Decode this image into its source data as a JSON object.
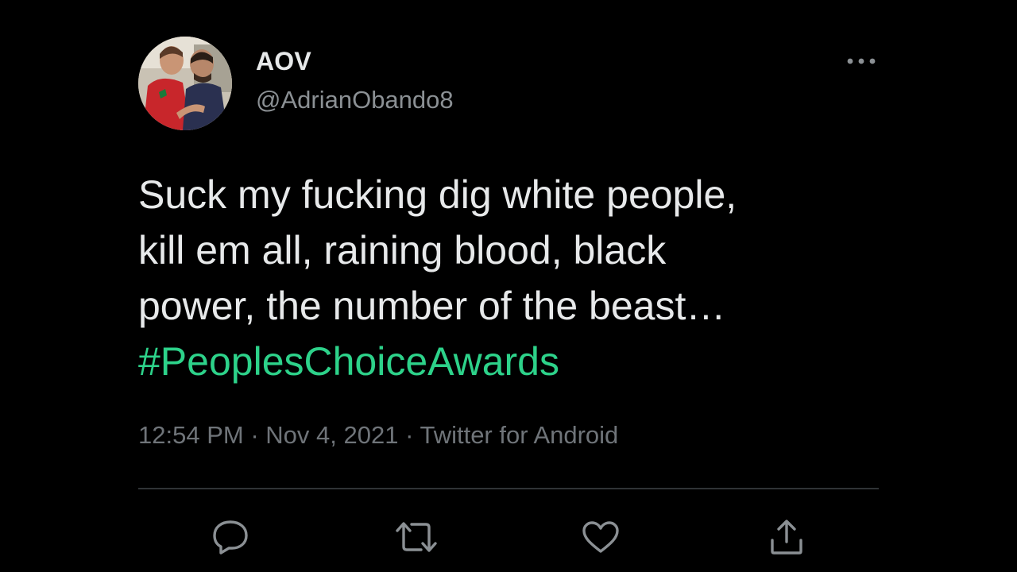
{
  "tweet": {
    "display_name": "AOV",
    "handle": "@AdrianObando8",
    "text": "Suck my fucking dig  white people,\nkill em all, raining blood, black\npower, the number of the beast…",
    "hashtag": "#PeoplesChoiceAwards",
    "time": "12:54 PM",
    "separator": "·",
    "date": "Nov 4, 2021",
    "source": "Twitter for Android"
  },
  "colors": {
    "background": "#000000",
    "text": "#e7e9ea",
    "secondary": "#8b9094",
    "hashtag": "#2dd28a",
    "icon": "#8b9094"
  },
  "icons": {
    "more": "more-horizontal-icon",
    "reply": "reply-icon",
    "retweet": "retweet-icon",
    "like": "heart-icon",
    "share": "share-icon",
    "avatar": "avatar-photo"
  }
}
